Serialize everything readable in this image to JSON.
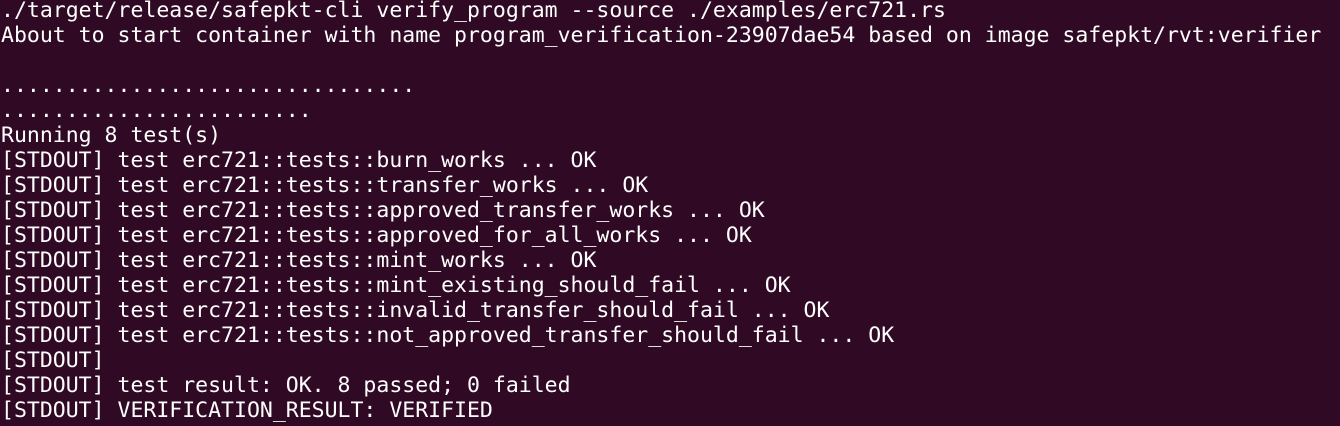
{
  "terminal": {
    "background": "#300a24",
    "foreground": "#ffffff",
    "lines": [
      "./target/release/safepkt-cli verify_program --source ./examples/erc721.rs",
      "About to start container with name program_verification-23907dae54 based on image safepkt/rvt:verifier",
      "",
      "................................",
      "........................",
      "Running 8 test(s)",
      "[STDOUT] test erc721::tests::burn_works ... OK",
      "[STDOUT] test erc721::tests::transfer_works ... OK",
      "[STDOUT] test erc721::tests::approved_transfer_works ... OK",
      "[STDOUT] test erc721::tests::approved_for_all_works ... OK",
      "[STDOUT] test erc721::tests::mint_works ... OK",
      "[STDOUT] test erc721::tests::mint_existing_should_fail ... OK",
      "[STDOUT] test erc721::tests::invalid_transfer_should_fail ... OK",
      "[STDOUT] test erc721::tests::not_approved_transfer_should_fail ... OK",
      "[STDOUT]",
      "[STDOUT] test result: OK. 8 passed; 0 failed",
      "[STDOUT] VERIFICATION_RESULT: VERIFIED"
    ]
  }
}
